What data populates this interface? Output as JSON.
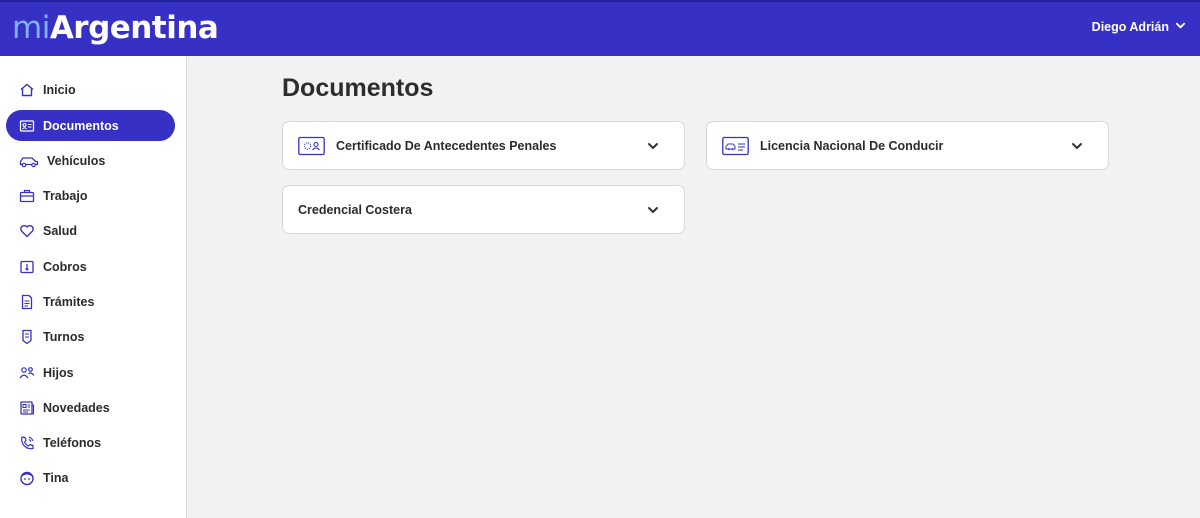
{
  "header": {
    "logo_mi": "mi",
    "logo_rest": "Argentina",
    "user_name": "Diego Adrián"
  },
  "sidebar": {
    "items": [
      {
        "label": "Inicio",
        "icon": "home-icon"
      },
      {
        "label": "Documentos",
        "icon": "id-card-icon",
        "active": true
      },
      {
        "label": "Vehículos",
        "icon": "car-icon"
      },
      {
        "label": "Trabajo",
        "icon": "briefcase-icon"
      },
      {
        "label": "Salud",
        "icon": "heart-icon"
      },
      {
        "label": "Cobros",
        "icon": "money-icon"
      },
      {
        "label": "Trámites",
        "icon": "document-icon"
      },
      {
        "label": "Turnos",
        "icon": "calendar-tag-icon"
      },
      {
        "label": "Hijos",
        "icon": "people-icon"
      },
      {
        "label": "Novedades",
        "icon": "newspaper-icon"
      },
      {
        "label": "Teléfonos",
        "icon": "phone-icon"
      },
      {
        "label": "Tina",
        "icon": "bot-face-icon"
      }
    ]
  },
  "main": {
    "title": "Documentos",
    "cards": [
      {
        "title": "Certificado De Antecedentes Penales",
        "icon": "certificate-card-icon"
      },
      {
        "title": "Licencia Nacional De Conducir",
        "icon": "license-card-icon"
      },
      {
        "title": "Credencial Costera",
        "icon": ""
      }
    ]
  },
  "colors": {
    "brand": "#3630c4",
    "logo_accent": "#7fb2ff",
    "background": "#f2f2f2"
  }
}
